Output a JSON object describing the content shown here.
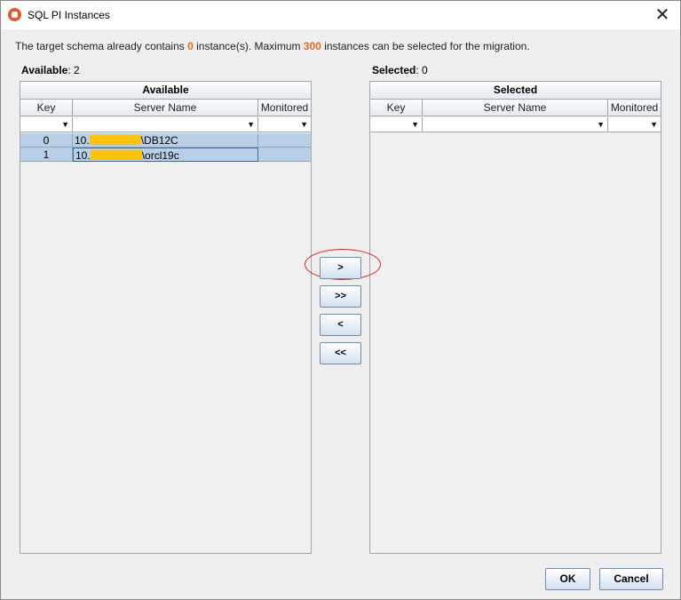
{
  "window": {
    "title": "SQL PI Instances",
    "close_glyph": "✕"
  },
  "info": {
    "prefix": "The target schema already contains ",
    "instance_count": "0",
    "middle": " instance(s). Maximum ",
    "max_count": "300",
    "suffix": " instances can be selected for the migration."
  },
  "available": {
    "label": "Available",
    "count": ": 2",
    "title": "Available",
    "columns": [
      "Key",
      "Server Name",
      "Monitored"
    ],
    "rows": [
      {
        "key": "0",
        "server_prefix": "10.",
        "server_suffix": "\\DB12C",
        "monitored": ""
      },
      {
        "key": "1",
        "server_prefix": "10.",
        "server_suffix": "\\orcl19c",
        "monitored": ""
      }
    ]
  },
  "selected": {
    "label": "Selected",
    "count": ": 0",
    "title": "Selected",
    "columns": [
      "Key",
      "Server Name",
      "Monitored"
    ],
    "rows": []
  },
  "move_buttons": {
    "add": ">",
    "add_all": ">>",
    "remove": "<",
    "remove_all": "<<"
  },
  "filter_arrow": "▼",
  "buttons": {
    "ok": "OK",
    "cancel": "Cancel"
  },
  "colors": {
    "highlight": "#e06a1f",
    "row_selected": "#b8cfe5",
    "redaction": "#ffc20e",
    "annotation": "#dd2222"
  },
  "icons": {
    "app": "app-logo-icon",
    "close": "close-icon",
    "filter": "chevron-down-icon"
  }
}
